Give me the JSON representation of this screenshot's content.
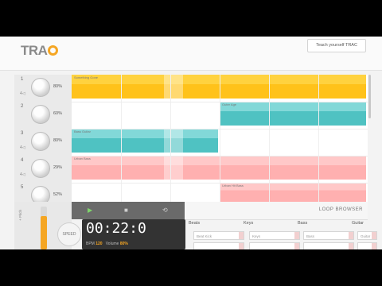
{
  "app": {
    "logo_text": "TRA",
    "teach_button": "Teach yourself TRAC"
  },
  "tracks": [
    {
      "num": "1",
      "sub": "4◁",
      "pct": "80%"
    },
    {
      "num": "2",
      "sub": "",
      "pct": "60%"
    },
    {
      "num": "3",
      "sub": "4◁",
      "pct": "80%"
    },
    {
      "num": "4",
      "sub": "4◁",
      "pct": "29%"
    },
    {
      "num": "5",
      "sub": "",
      "pct": "52%"
    }
  ],
  "clips": [
    {
      "label": "Something Gone",
      "color": "#ffd23f",
      "colorDark": "#ffc21a"
    },
    {
      "label": "Outer Age",
      "color": "#82d8d8",
      "colorDark": "#4fc2c2"
    },
    {
      "label": "Bass Guitar",
      "color": "#82d8d8",
      "colorDark": "#4fc2c2"
    },
    {
      "label": "Urban Bass",
      "color": "#ffc8c8",
      "colorDark": "#ffb0b0"
    },
    {
      "label": "Urban Hit Bass",
      "color": "#ffc8c8",
      "colorDark": "#ffb0b0"
    }
  ],
  "transport": {
    "play_icon": "▶",
    "stop_icon": "■",
    "loop_icon": "⟲"
  },
  "browser": {
    "title": "LOOP BROWSER",
    "columns": [
      "Beats",
      "Keys",
      "Bass",
      "Guitar"
    ],
    "selects": [
      "Beat Kick",
      "Keys",
      "Bass",
      "Guitar Long"
    ]
  },
  "clock": {
    "time": "00:22:0",
    "bpm_label": "BPM",
    "bpm": "120",
    "volume_label": "Volume",
    "volume": "80%"
  },
  "controls": {
    "speed_label": "SPEED",
    "slider_label": "+ Pitch",
    "slider_level": 0.78
  },
  "colors": {
    "accent": "#f5a623"
  }
}
